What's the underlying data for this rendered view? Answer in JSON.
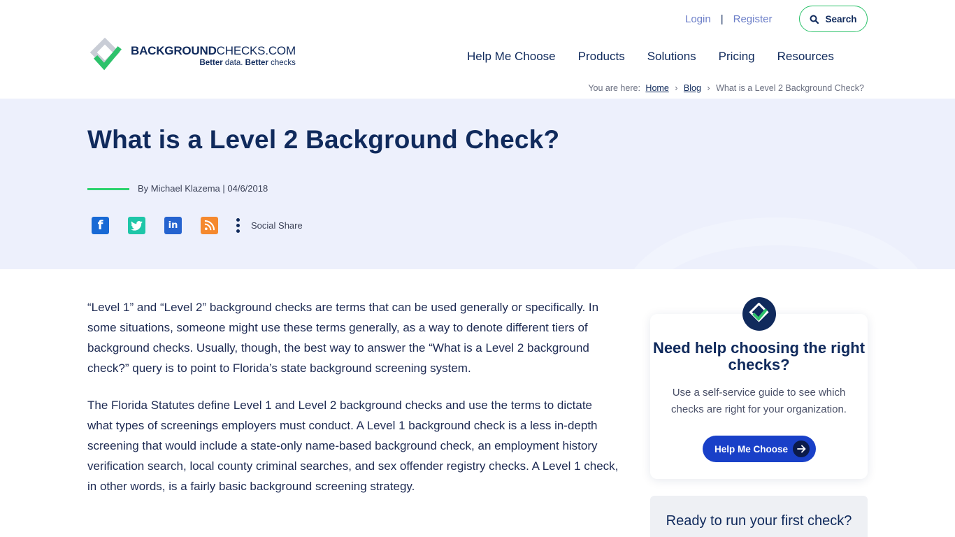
{
  "brand": {
    "name_bold": "BACKGROUND",
    "name_regular": "CHECKS.COM",
    "tagline_bold_1": "Better",
    "tagline_regular_1": " data. ",
    "tagline_bold_2": "Better",
    "tagline_regular_2": " checks",
    "colors": {
      "navy": "#102a5c",
      "green": "#2dc26b",
      "blue": "#1940c8",
      "hero_bg": "#edf0fc"
    }
  },
  "toplinks": {
    "login": "Login",
    "separator": "|",
    "register": "Register",
    "search_label": "Search"
  },
  "nav": {
    "items": [
      {
        "label": "Help Me Choose"
      },
      {
        "label": "Products"
      },
      {
        "label": "Solutions"
      },
      {
        "label": "Pricing"
      },
      {
        "label": "Resources"
      }
    ]
  },
  "breadcrumb": {
    "prefix": "You are here:",
    "home": "Home",
    "blog": "Blog",
    "current": "What is a Level 2 Background Check?",
    "arrow": "›"
  },
  "hero": {
    "title": "What is a Level 2 Background Check?",
    "byline": "By Michael Klazema | 04/6/2018",
    "social": {
      "facebook_icon": "f",
      "twitter_icon": "t",
      "linkedin_icon": "in",
      "rss_icon": "rss",
      "share_label": "Social Share"
    }
  },
  "article": {
    "paragraphs": [
      "“Level 1” and “Level 2” background checks are terms that can be used generally or specifically. In some situations, someone might use these terms generally, as a way to denote different tiers of background checks. Usually, though, the best way to answer the “What is a Level 2 background check?” query is to point to Florida’s state background screening system.",
      "The Florida Statutes define Level 1 and Level 2 background checks and use the terms to dictate what types of screenings employers must conduct. A Level 1 background check is a less in-depth screening that would include a state-only name-based background check, an employment history verification search, local county criminal searches, and sex offender registry checks. A Level 1 check, in other words, is a fairly basic background screening strategy."
    ]
  },
  "sidebar": {
    "card_title": "Need help choosing the right checks?",
    "card_text": "Use a self-service guide to see which checks are right for your organization.",
    "card_button": "Help Me Choose",
    "card2_title": "Ready to run your first check?"
  }
}
